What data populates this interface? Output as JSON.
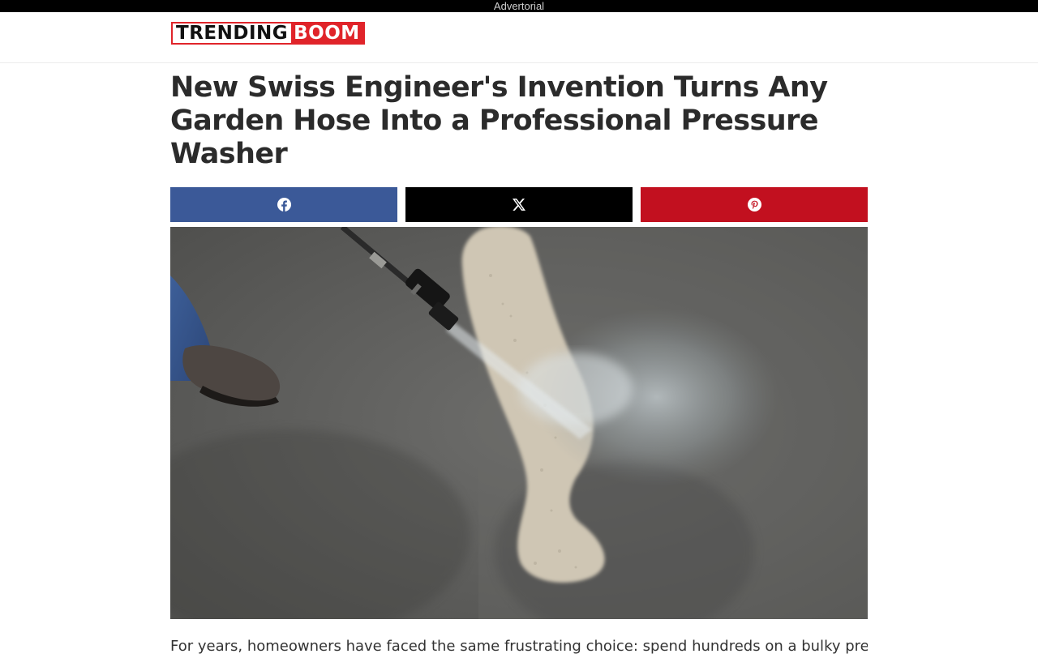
{
  "ad_bar": {
    "label": "Advertorial"
  },
  "site": {
    "logo_part1": "TRENDING",
    "logo_part2": "BOOM",
    "brand_colors": {
      "red": "#e0242a",
      "dark": "#111111"
    }
  },
  "article": {
    "headline": "New Swiss Engineer's Invention Turns Any Garden Hose Into a Professional Pressure Washer",
    "intro": "For years, homeowners have faced the same frustrating choice: spend hundreds on a bulky pressure"
  },
  "share_buttons": [
    {
      "network": "facebook",
      "icon": "facebook-icon",
      "color": "#3b5998"
    },
    {
      "network": "x",
      "icon": "x-icon",
      "color": "#000000"
    },
    {
      "network": "pinterest",
      "icon": "pinterest-icon",
      "color": "#c2101f"
    }
  ],
  "hero_image": {
    "subject": "pressure-washer-wand-cleaning-concrete"
  }
}
